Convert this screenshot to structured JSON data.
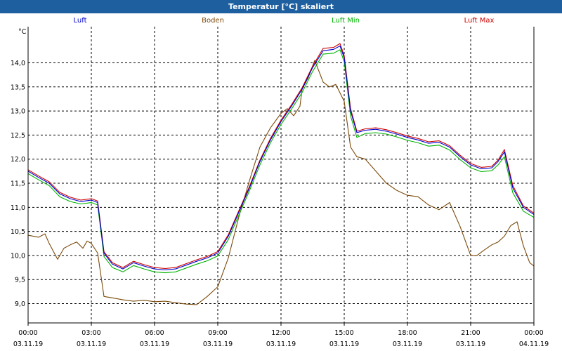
{
  "window": {
    "title": "Temperatur [°C] skaliert"
  },
  "chart_data": {
    "type": "line",
    "title": "Temperatur [°C] skaliert",
    "ylabel": "°C",
    "xlabel": "",
    "ylim": [
      8.6,
      14.75
    ],
    "yticks": [
      9.0,
      9.5,
      10.0,
      10.5,
      11.0,
      11.5,
      12.0,
      12.5,
      13.0,
      13.5,
      14.0
    ],
    "ytick_labels": [
      "9,0",
      "9,5",
      "10,0",
      "10,5",
      "11,0",
      "11,5",
      "12,0",
      "12,5",
      "13,0",
      "13,5",
      "14,0"
    ],
    "xlim": [
      0,
      24
    ],
    "xticks": [
      0,
      3,
      6,
      9,
      12,
      15,
      18,
      21,
      24
    ],
    "xtick_times": [
      "00:00",
      "03:00",
      "06:00",
      "09:00",
      "12:00",
      "15:00",
      "18:00",
      "21:00",
      "00:00"
    ],
    "xtick_dates": [
      "03.11.19",
      "03.11.19",
      "03.11.19",
      "03.11.19",
      "03.11.19",
      "03.11.19",
      "03.11.19",
      "03.11.19",
      "04.11.19"
    ],
    "grid": true,
    "legend_position": "top",
    "series": [
      {
        "name": "Luft",
        "color": "#0000cc",
        "x": [
          0,
          0.5,
          1,
          1.5,
          2,
          2.5,
          3,
          3.3,
          3.6,
          4,
          4.5,
          5,
          5.5,
          6,
          6.5,
          7,
          7.5,
          8,
          8.5,
          9,
          9.5,
          10,
          10.5,
          11,
          11.5,
          12,
          12.5,
          13,
          13.5,
          14,
          14.5,
          14.8,
          15,
          15.3,
          15.6,
          16,
          16.5,
          17,
          17.5,
          18,
          18.5,
          19,
          19.5,
          20,
          20.5,
          21,
          21.5,
          22,
          22.3,
          22.6,
          23,
          23.5,
          24
        ],
        "y": [
          11.75,
          11.62,
          11.5,
          11.28,
          11.18,
          11.12,
          11.15,
          11.1,
          10.05,
          9.82,
          9.72,
          9.85,
          9.78,
          9.72,
          9.7,
          9.72,
          9.8,
          9.88,
          9.95,
          10.05,
          10.4,
          10.9,
          11.4,
          11.95,
          12.4,
          12.78,
          13.1,
          13.45,
          13.9,
          14.25,
          14.28,
          14.35,
          14.1,
          13.0,
          12.55,
          12.6,
          12.62,
          12.58,
          12.52,
          12.45,
          12.4,
          12.33,
          12.35,
          12.25,
          12.05,
          11.88,
          11.8,
          11.82,
          11.95,
          12.15,
          11.4,
          11.0,
          10.85
        ]
      },
      {
        "name": "Boden",
        "color": "#7b4a0a",
        "x": [
          0,
          0.5,
          0.8,
          1,
          1.4,
          1.7,
          2,
          2.3,
          2.6,
          2.8,
          3,
          3.3,
          3.6,
          4,
          4.5,
          5,
          5.5,
          6,
          6.5,
          7,
          7.5,
          8,
          8.5,
          9,
          9.5,
          10,
          10.5,
          11,
          11.5,
          12,
          12.3,
          12.6,
          12.9,
          13,
          13.3,
          13.6,
          14,
          14.3,
          14.6,
          15,
          15.3,
          15.6,
          16,
          16.5,
          17,
          17.5,
          18,
          18.5,
          19,
          19.5,
          20,
          20.5,
          21,
          21.3,
          21.6,
          22,
          22.3,
          22.6,
          22.9,
          23.2,
          23.5,
          23.8,
          24
        ],
        "y": [
          10.42,
          10.38,
          10.45,
          10.25,
          9.92,
          10.15,
          10.22,
          10.28,
          10.15,
          10.3,
          10.25,
          10.05,
          9.15,
          9.12,
          9.08,
          9.05,
          9.07,
          9.04,
          9.05,
          9.02,
          8.99,
          8.98,
          9.15,
          9.35,
          9.95,
          10.8,
          11.55,
          12.25,
          12.65,
          12.95,
          13.05,
          12.9,
          13.1,
          13.45,
          13.7,
          14.05,
          13.6,
          13.5,
          13.55,
          13.2,
          12.25,
          12.05,
          12.0,
          11.75,
          11.5,
          11.35,
          11.25,
          11.22,
          11.05,
          10.95,
          11.1,
          10.6,
          10.0,
          10.0,
          10.1,
          10.22,
          10.28,
          10.4,
          10.62,
          10.7,
          10.2,
          9.85,
          9.78
        ]
      },
      {
        "name": "Luft Min",
        "color": "#00b400",
        "x": [
          0,
          0.5,
          1,
          1.5,
          2,
          2.5,
          3,
          3.3,
          3.6,
          4,
          4.5,
          5,
          5.5,
          6,
          6.5,
          7,
          7.5,
          8,
          8.5,
          9,
          9.5,
          10,
          10.5,
          11,
          11.5,
          12,
          12.5,
          13,
          13.5,
          14,
          14.5,
          14.8,
          15,
          15.3,
          15.6,
          16,
          16.5,
          17,
          17.5,
          18,
          18.5,
          19,
          19.5,
          20,
          20.5,
          21,
          21.5,
          22,
          22.3,
          22.6,
          23,
          23.5,
          24
        ],
        "y": [
          11.7,
          11.57,
          11.45,
          11.22,
          11.12,
          11.07,
          11.1,
          11.05,
          9.98,
          9.75,
          9.66,
          9.79,
          9.72,
          9.66,
          9.64,
          9.66,
          9.74,
          9.82,
          9.89,
          9.99,
          10.33,
          10.84,
          11.34,
          11.88,
          12.34,
          12.72,
          13.04,
          13.38,
          13.82,
          14.18,
          14.2,
          14.27,
          14.02,
          12.9,
          12.45,
          12.53,
          12.55,
          12.52,
          12.46,
          12.39,
          12.34,
          12.27,
          12.29,
          12.19,
          11.99,
          11.82,
          11.74,
          11.76,
          11.88,
          12.05,
          11.3,
          10.92,
          10.79
        ]
      },
      {
        "name": "Luft Max",
        "color": "#cc0000",
        "x": [
          0,
          0.5,
          1,
          1.5,
          2,
          2.5,
          3,
          3.3,
          3.6,
          4,
          4.5,
          5,
          5.5,
          6,
          6.5,
          7,
          7.5,
          8,
          8.5,
          9,
          9.5,
          10,
          10.5,
          11,
          11.5,
          12,
          12.5,
          13,
          13.5,
          14,
          14.5,
          14.8,
          15,
          15.3,
          15.6,
          16,
          16.5,
          17,
          17.5,
          18,
          18.5,
          19,
          19.5,
          20,
          20.5,
          21,
          21.5,
          22,
          22.3,
          22.6,
          23,
          23.5,
          24
        ],
        "y": [
          11.78,
          11.65,
          11.53,
          11.31,
          11.21,
          11.15,
          11.18,
          11.13,
          10.08,
          9.85,
          9.75,
          9.88,
          9.81,
          9.75,
          9.73,
          9.75,
          9.83,
          9.91,
          9.98,
          10.08,
          10.43,
          10.93,
          11.43,
          11.98,
          12.43,
          12.81,
          13.13,
          13.48,
          13.93,
          14.3,
          14.32,
          14.4,
          14.15,
          13.05,
          12.58,
          12.63,
          12.65,
          12.61,
          12.55,
          12.48,
          12.43,
          12.36,
          12.38,
          12.28,
          12.08,
          11.91,
          11.83,
          11.85,
          11.98,
          12.2,
          11.45,
          11.03,
          10.88
        ]
      }
    ]
  }
}
